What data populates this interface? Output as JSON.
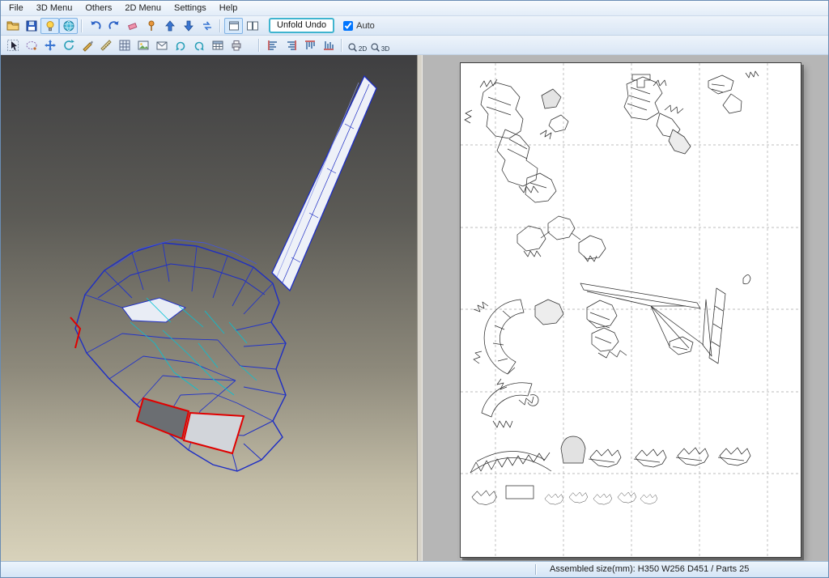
{
  "menu": {
    "items": [
      "File",
      "3D Menu",
      "Others",
      "2D Menu",
      "Settings",
      "Help"
    ]
  },
  "toolbar": {
    "unfold_undo": "Unfold Undo",
    "auto": "Auto",
    "auto_checked": true,
    "zoom2d": "2D",
    "zoom3d": "3D"
  },
  "status": {
    "assembled": "Assembled size(mm): H350 W256 D451 / Parts 25"
  },
  "colors": {
    "unfold_button_border": "#3fb4cf",
    "wireframe_blue": "#1e2ec4",
    "wireframe_cyan": "#00c4d6",
    "highlight_red": "#e00000",
    "viewport_top": "#3f3f41",
    "viewport_bottom": "#d8d2bb"
  }
}
